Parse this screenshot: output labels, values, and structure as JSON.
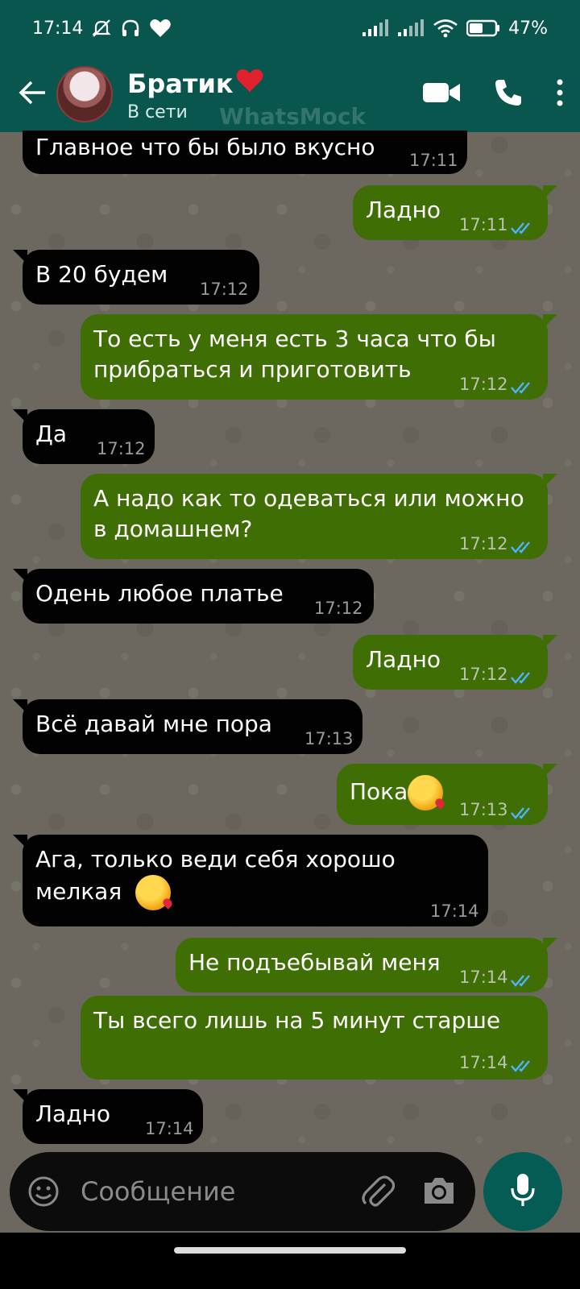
{
  "status_bar": {
    "time": "17:14",
    "battery": "47%"
  },
  "header": {
    "contact_name": "Братик",
    "contact_status": "В сети",
    "watermark": "WhatsMock"
  },
  "messages": [
    {
      "dir": "in",
      "text": "Главное что бы было вкусно",
      "time": "17:11"
    },
    {
      "dir": "out",
      "text": "Ладно",
      "time": "17:11"
    },
    {
      "dir": "in",
      "text": "В 20 будем",
      "time": "17:12"
    },
    {
      "dir": "out",
      "text_line1": "То есть у меня есть 3 часа что бы",
      "text_line2": "прибраться и приготовить",
      "time": "17:12"
    },
    {
      "dir": "in",
      "text": "Да",
      "time": "17:12"
    },
    {
      "dir": "out",
      "text_line1": "А надо как то одеваться или можно",
      "text_line2": "в домашнем?",
      "time": "17:12"
    },
    {
      "dir": "in",
      "text": "Одень любое платье",
      "time": "17:12"
    },
    {
      "dir": "out",
      "text": "Ладно",
      "time": "17:12"
    },
    {
      "dir": "in",
      "text": "Всё давай мне пора",
      "time": "17:13"
    },
    {
      "dir": "out",
      "text": "Пока",
      "time": "17:13",
      "emoji": "kissing-face-emoji"
    },
    {
      "dir": "in",
      "text_line1": "Ага, только веди себя хорошо",
      "text_line2": "мелкая",
      "time": "17:14",
      "emoji": "kissing-face-emoji"
    },
    {
      "dir": "out",
      "text": "Не подъебывай меня",
      "time": "17:14"
    },
    {
      "dir": "out",
      "text": "Ты всего лишь на 5 минут старше",
      "time": "17:14"
    },
    {
      "dir": "in",
      "text": "Ладно",
      "time": "17:14"
    }
  ],
  "input": {
    "placeholder": "Сообщение"
  },
  "colors": {
    "header_bg": "#08564e",
    "incoming_bubble": "#020202",
    "outgoing_bubble": "#3f6e04",
    "read_ticks": "#4fb3ff",
    "mic_button": "#045c54"
  },
  "icons": [
    "back-arrow-icon",
    "video-call-icon",
    "phone-call-icon",
    "more-options-icon",
    "emoji-icon",
    "attach-icon",
    "camera-icon",
    "mic-icon",
    "read-ticks-icon"
  ]
}
